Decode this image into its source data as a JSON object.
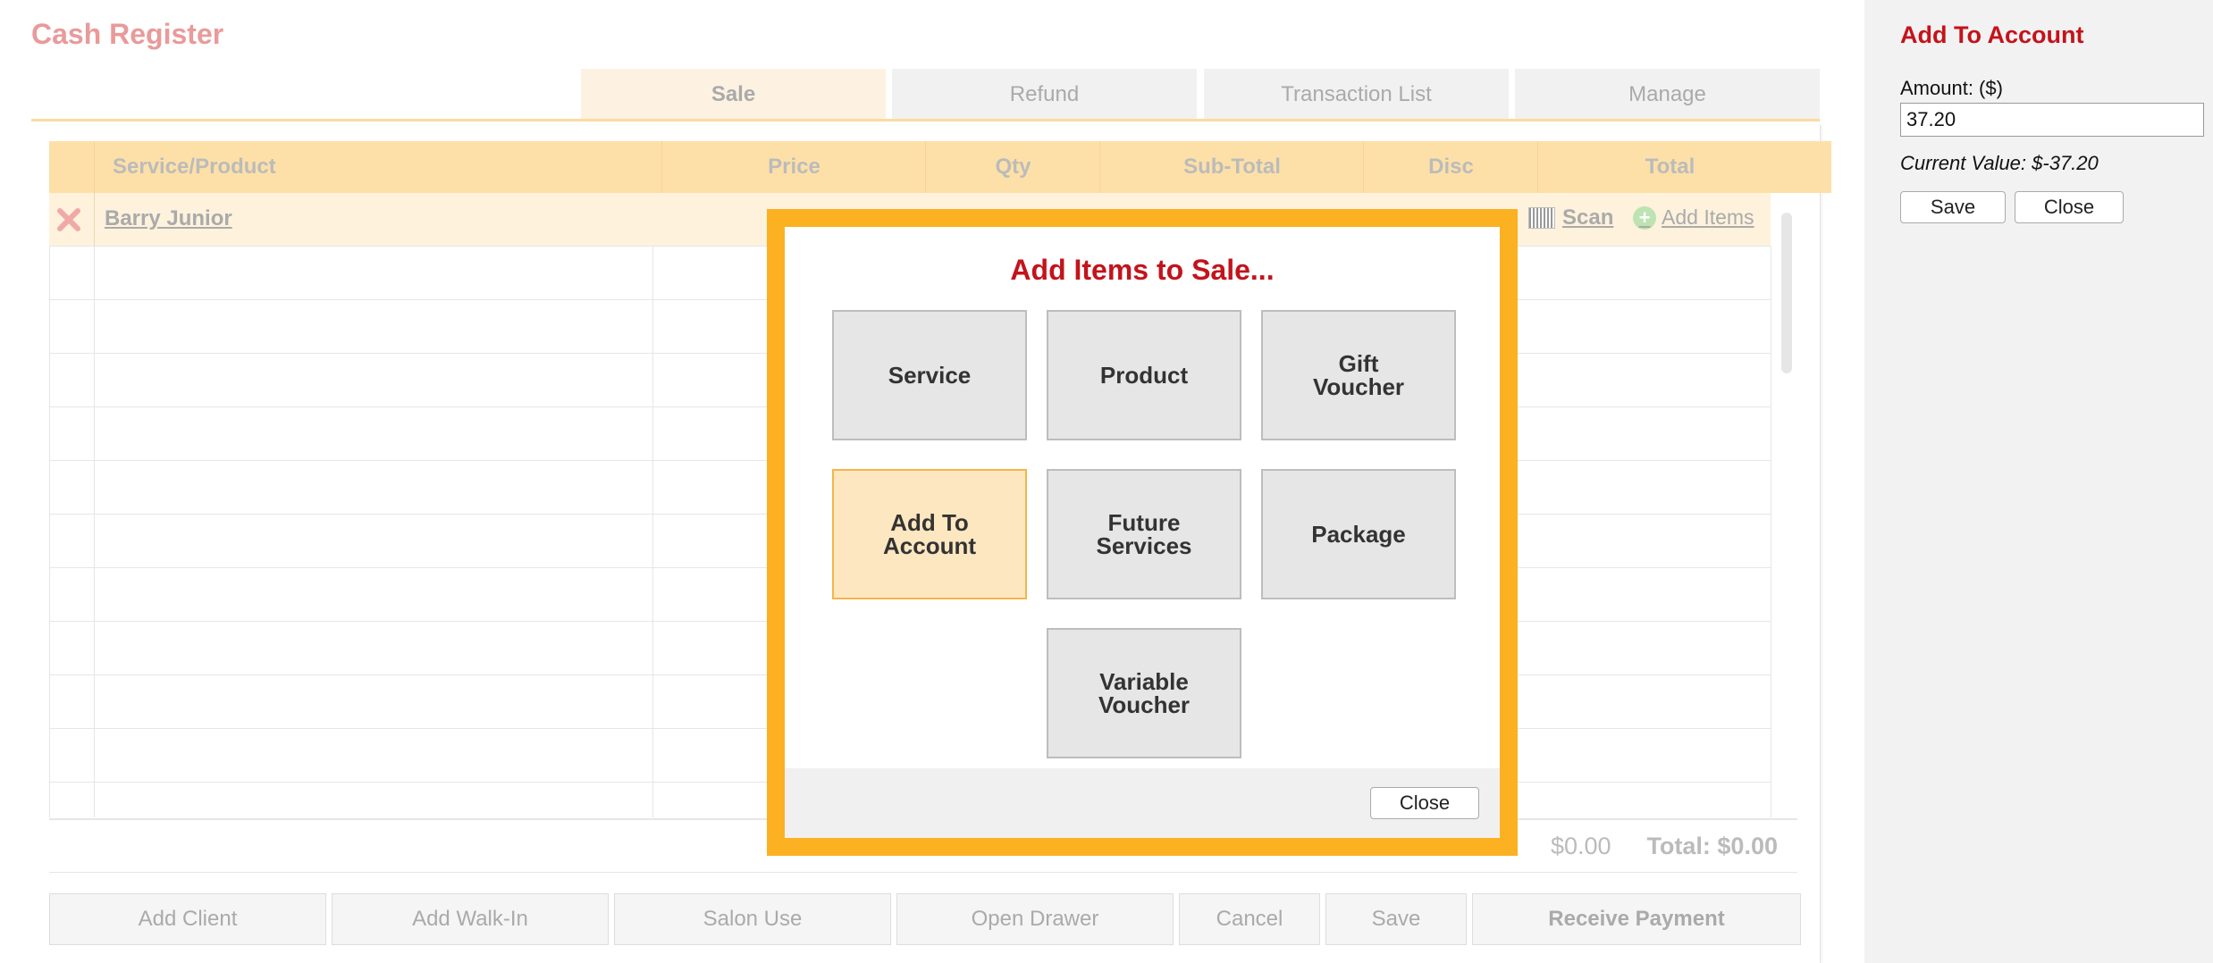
{
  "app": {
    "title": "Cash Register"
  },
  "tabs": [
    {
      "label": "Sale",
      "active": true
    },
    {
      "label": "Refund",
      "active": false
    },
    {
      "label": "Transaction List",
      "active": false
    },
    {
      "label": "Manage",
      "active": false
    }
  ],
  "grid": {
    "columns": [
      "Service/Product",
      "Price",
      "Qty",
      "Sub-Total",
      "Disc",
      "Total"
    ],
    "client_name": "Barry Junior",
    "scan_label": "Scan",
    "add_items_label": "Add Items",
    "disc_total": "$0.00",
    "grand_total": "Total: $0.00"
  },
  "bottom_bar": {
    "add_client": "Add Client",
    "add_walk_in": "Add Walk-In",
    "salon_use": "Salon Use",
    "open_drawer": "Open Drawer",
    "cancel": "Cancel",
    "save": "Save",
    "receive_payment": "Receive Payment"
  },
  "modal": {
    "title": "Add Items to Sale...",
    "tiles": {
      "service": "Service",
      "product": "Product",
      "gift_voucher": "Gift\nVoucher",
      "add_to_account": "Add To\nAccount",
      "future_services": "Future\nServices",
      "package": "Package",
      "variable_voucher": "Variable\nVoucher"
    },
    "selected_tile": "add_to_account",
    "close_label": "Close"
  },
  "side_panel": {
    "title": "Add To Account",
    "amount_label": "Amount: ($)",
    "amount_value": "37.20",
    "current_value": "Current Value: $-37.20",
    "save_label": "Save",
    "close_label": "Close"
  },
  "colors": {
    "accent_orange": "#fbb122",
    "title_red": "#c4131b",
    "header_peach": "#fde0a8",
    "selected_tile": "#fde7c0"
  }
}
